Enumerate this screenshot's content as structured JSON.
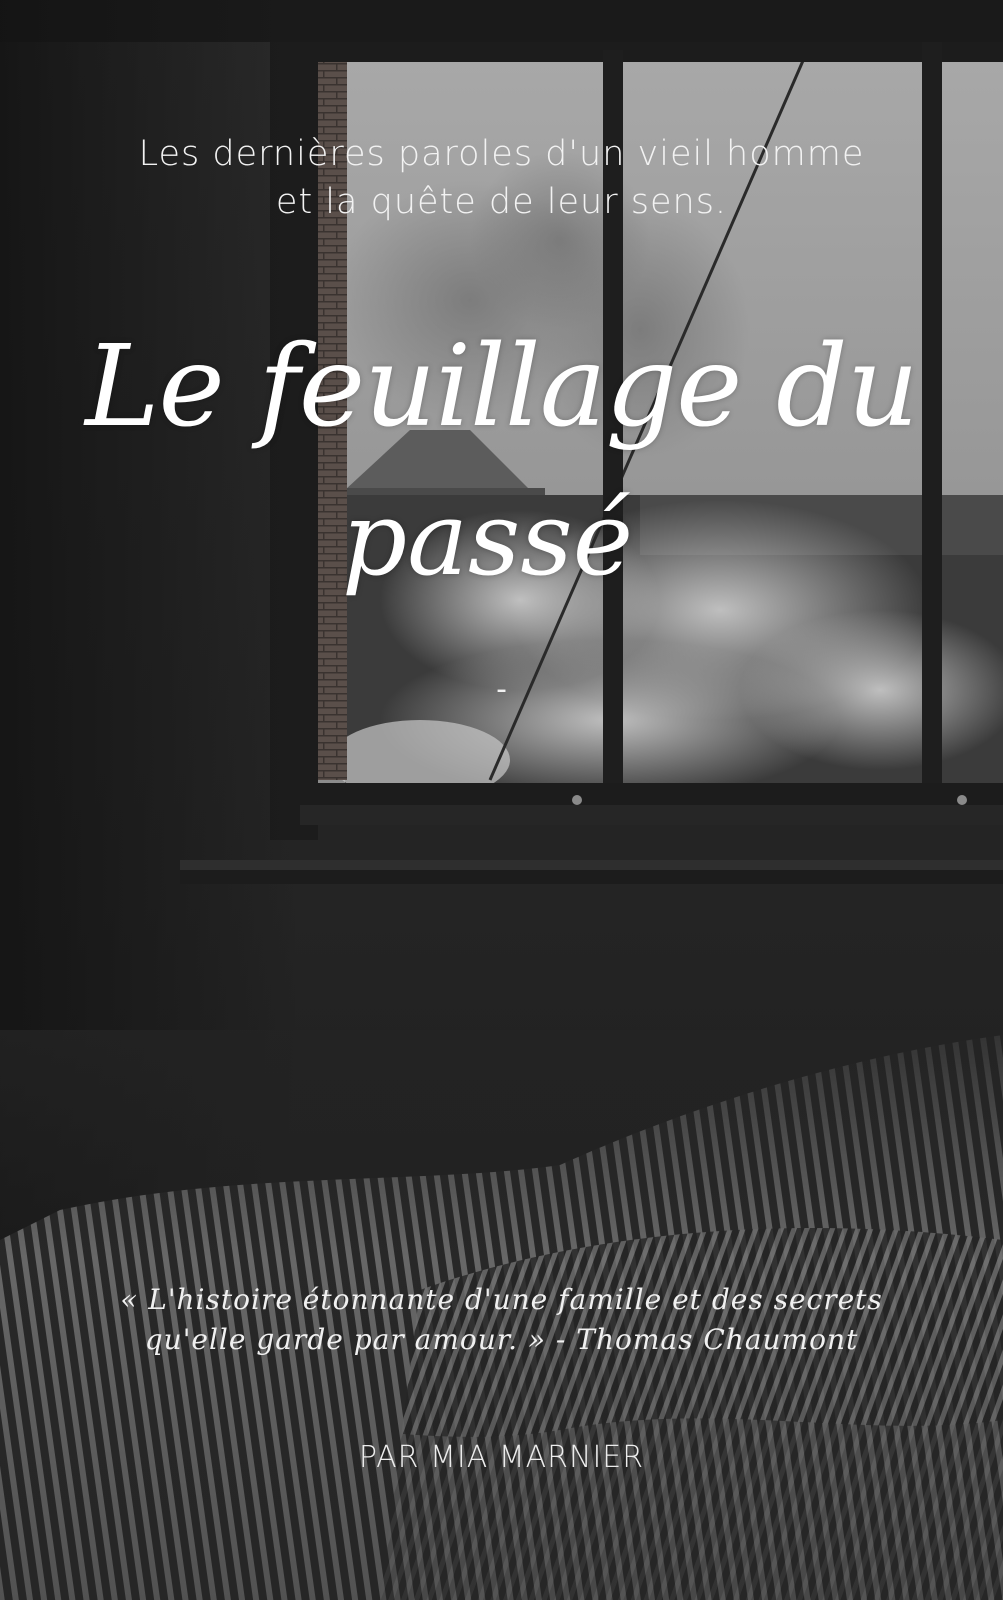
{
  "cover": {
    "subtitle_lines": [
      "Les dernières paroles d'un vieil homme",
      "et la quête de leur sens."
    ],
    "title_lines": [
      "Le feuillage du",
      "passé"
    ],
    "separator": "-",
    "quote_lines": [
      "« L'histoire étonnante d'une famille et des secrets",
      "qu'elle garde par amour. » - Thomas Chaumont"
    ],
    "author": "PAR MIA MARNIER"
  },
  "colors": {
    "background": "#232323",
    "text": "#ffffff",
    "window_glass": "#9a9a9a",
    "window_frame": "#1c1c1c"
  }
}
